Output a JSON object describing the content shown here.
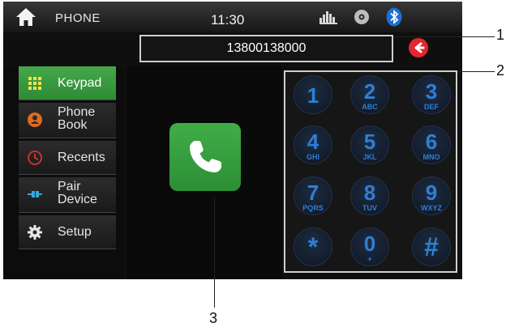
{
  "status_bar": {
    "title": "PHONE",
    "time": "11:30"
  },
  "dial": {
    "number": "13800138000"
  },
  "menu": [
    {
      "label": "Keypad",
      "icon": "keypad-icon",
      "active": true
    },
    {
      "label": "Phone\nBook",
      "icon": "phonebook-icon",
      "active": false
    },
    {
      "label": "Recents",
      "icon": "recents-icon",
      "active": false
    },
    {
      "label": "Pair\nDevice",
      "icon": "pair-device-icon",
      "active": false
    },
    {
      "label": "Setup",
      "icon": "gear-icon",
      "active": false
    }
  ],
  "keypad": [
    {
      "digit": "1",
      "letters": ""
    },
    {
      "digit": "2",
      "letters": "ABC"
    },
    {
      "digit": "3",
      "letters": "DEF"
    },
    {
      "digit": "4",
      "letters": "GHI"
    },
    {
      "digit": "5",
      "letters": "JKL"
    },
    {
      "digit": "6",
      "letters": "MNO"
    },
    {
      "digit": "7",
      "letters": "PQRS"
    },
    {
      "digit": "8",
      "letters": "TUV"
    },
    {
      "digit": "9",
      "letters": "WXYZ"
    },
    {
      "digit": "*",
      "letters": ""
    },
    {
      "digit": "0",
      "letters": "+"
    },
    {
      "digit": "#",
      "letters": ""
    }
  ],
  "callouts": {
    "c1": "1",
    "c2": "2",
    "c3": "3"
  },
  "colors": {
    "accent_green": "#3a9d41",
    "key_blue": "#2e7fd6",
    "backspace_red": "#e3262f",
    "bluetooth_blue": "#1c6fd1"
  }
}
